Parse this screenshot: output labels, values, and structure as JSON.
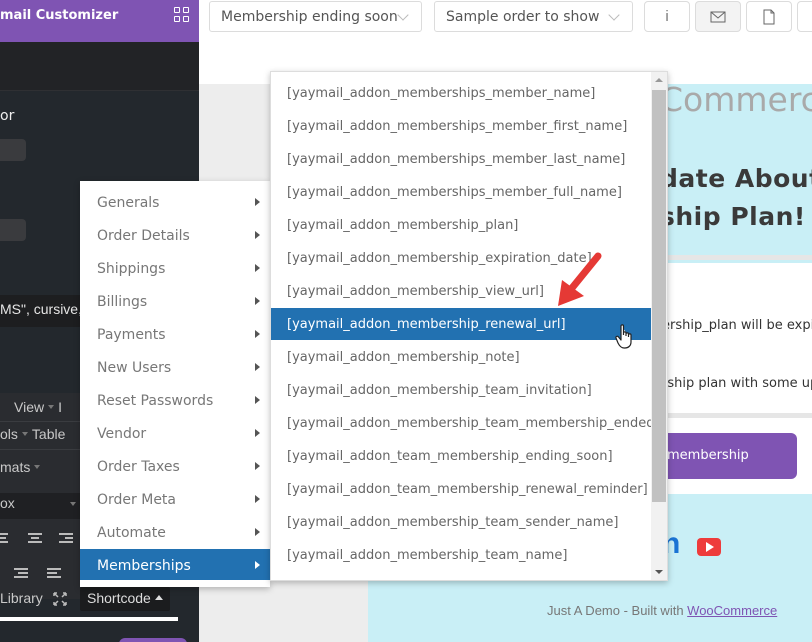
{
  "sidebar": {
    "title": "mail Customizer",
    "label_or": "or",
    "font_value": "MS\", cursive,",
    "toolbar": {
      "row1": [
        "View",
        "I"
      ],
      "row2": [
        "ols",
        "Table"
      ],
      "row3": [
        "mats"
      ],
      "row4": [
        "ox"
      ],
      "library_label": "Library",
      "shortcode_label": "Shortcode"
    }
  },
  "topbar": {
    "email_type_select": "Membership ending soon",
    "sample_order_select": "Sample order to show",
    "buttons": [
      {
        "name": "info",
        "glyph": "i"
      },
      {
        "name": "email",
        "glyph": "✉"
      },
      {
        "name": "document",
        "glyph": "🗋"
      }
    ]
  },
  "category_menu": {
    "items": [
      {
        "label": "Generals",
        "selected": false
      },
      {
        "label": "Order Details",
        "selected": false
      },
      {
        "label": "Shippings",
        "selected": false
      },
      {
        "label": "Billings",
        "selected": false
      },
      {
        "label": "Payments",
        "selected": false
      },
      {
        "label": "New Users",
        "selected": false
      },
      {
        "label": "Reset Passwords",
        "selected": false
      },
      {
        "label": "Vendor",
        "selected": false
      },
      {
        "label": "Order Taxes",
        "selected": false
      },
      {
        "label": "Order Meta",
        "selected": false
      },
      {
        "label": "Automate",
        "selected": false
      },
      {
        "label": "Memberships",
        "selected": true
      }
    ]
  },
  "shortcode_menu": {
    "items": [
      {
        "label": "[yaymail_addon_memberships_member_name]",
        "selected": false
      },
      {
        "label": "[yaymail_addon_memberships_member_first_name]",
        "selected": false
      },
      {
        "label": "[yaymail_addon_memberships_member_last_name]",
        "selected": false
      },
      {
        "label": "[yaymail_addon_memberships_member_full_name]",
        "selected": false
      },
      {
        "label": "[yaymail_addon_membership_plan]",
        "selected": false
      },
      {
        "label": "[yaymail_addon_membership_expiration_date]",
        "selected": false
      },
      {
        "label": "[yaymail_addon_membership_view_url]",
        "selected": false
      },
      {
        "label": "[yaymail_addon_membership_renewal_url]",
        "selected": true
      },
      {
        "label": "[yaymail_addon_membership_note]",
        "selected": false
      },
      {
        "label": "[yaymail_addon_membership_team_invitation]",
        "selected": false
      },
      {
        "label": "[yaymail_addon_membership_team_membership_ended]",
        "selected": false
      },
      {
        "label": "[yaymail_addon_team_membership_ending_soon]",
        "selected": false
      },
      {
        "label": "[yaymail_addon_team_membership_renewal_reminder]",
        "selected": false
      },
      {
        "label": "[yaymail_addon_membership_team_sender_name]",
        "selected": false
      },
      {
        "label": "[yaymail_addon_membership_team_name]",
        "selected": false
      }
    ]
  },
  "email_preview": {
    "logo_text": "Commerc",
    "heading_line1": "date About",
    "heading_line2": "ship Plan!",
    "body_line1": "ership_plan will be expi",
    "body_line2": "rship plan with some up",
    "button_label": "membership",
    "social_text": "n",
    "footer_prefix": "Just A Demo - Built with ",
    "footer_link": "WooCommerce"
  },
  "colors": {
    "brand_purple": "#7f54b3",
    "selection_blue": "#2271b1",
    "email_bg": "#c9eff6",
    "annotation_red": "#e53935"
  }
}
